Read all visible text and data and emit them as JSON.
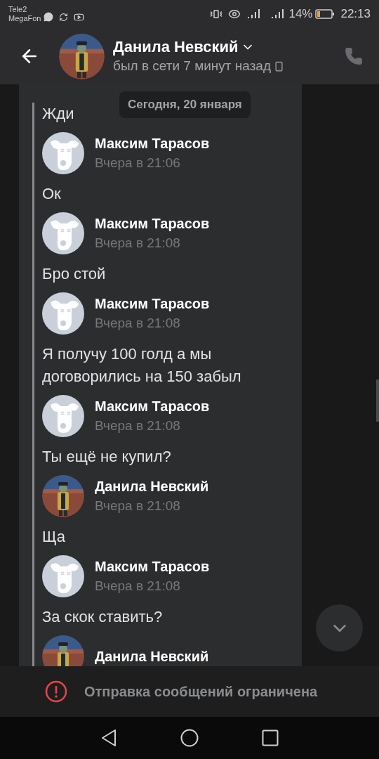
{
  "status_bar": {
    "carriers": [
      "Tele2",
      "MegaFon"
    ],
    "battery_percent": "14%",
    "time": "22:13"
  },
  "header": {
    "name": "Данила Невский",
    "status": "был в сети 7 минут назад"
  },
  "date_badge": "Сегодня, 20 января",
  "messages": [
    {
      "text": "Жди"
    },
    {
      "author": "Максим Тарасов",
      "time": "Вчера в 21:06",
      "kind": "default",
      "text": "Ок"
    },
    {
      "author": "Максим Тарасов",
      "time": "Вчера в 21:08",
      "kind": "default",
      "text": "Бро стой"
    },
    {
      "author": "Максим Тарасов",
      "time": "Вчера в 21:08",
      "kind": "default",
      "text": "Я получу 100 голд а мы договорились на 150 забыл"
    },
    {
      "author": "Максим Тарасов",
      "time": "Вчера в 21:08",
      "kind": "default",
      "text": "Ты ещё не купил?"
    },
    {
      "author": "Данила Невский",
      "time": "Вчера в 21:08",
      "text": "Ща"
    },
    {
      "author": "Максим Тарасов",
      "time": "Вчера в 21:08",
      "kind": "default",
      "text": "За скок ставить?"
    },
    {
      "author": "Данила Невский"
    }
  ],
  "notice": "Отправка сообщений ограничена"
}
